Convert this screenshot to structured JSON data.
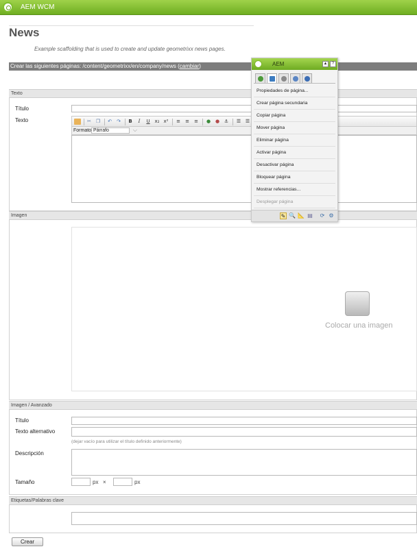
{
  "topbar": {
    "title": "AEM WCM"
  },
  "page": {
    "title": "News",
    "description": "Example scaffolding that is used to create and update geometrixx news pages."
  },
  "create_bar": {
    "prefix": "Crear las siguientes páginas: /content/geometrixx/en/company/news (",
    "link": "cambiar",
    "suffix": ")"
  },
  "sections": {
    "texto": {
      "header": "Texto",
      "title_label": "Título",
      "text_label": "Texto",
      "format_label": "Formato",
      "format_value": "Párrafo"
    },
    "imagen": {
      "header": "Imagen",
      "placeholder": "Colocar una imagen"
    },
    "avanzado": {
      "header": "Imagen / Avanzado",
      "title_label": "Título",
      "alt_label": "Texto alternativo",
      "alt_hint": "(dejar vacío para utilizar el título definido anteriormente)",
      "description_label": "Descripción",
      "size_label": "Tamaño",
      "unit": "px",
      "times": "×"
    },
    "tags": {
      "header": "Etiquetas/Palabras clave"
    }
  },
  "buttons": {
    "create": "Crear"
  },
  "sidekick": {
    "title": "AEM",
    "items": [
      {
        "label": "Propiedades de página...",
        "enabled": true
      },
      {
        "label": "Crear página secundaria",
        "enabled": true
      },
      {
        "label": "Copiar página",
        "enabled": true
      },
      {
        "label": "Mover página",
        "enabled": true
      },
      {
        "label": "Eliminar página",
        "enabled": true
      },
      {
        "label": "Activar página",
        "enabled": true
      },
      {
        "label": "Desactivar página",
        "enabled": true
      },
      {
        "label": "Bloquear página",
        "enabled": true
      },
      {
        "label": "Mostrar referencias...",
        "enabled": true
      },
      {
        "label": "Desplegar página",
        "enabled": false
      }
    ]
  },
  "colors": {
    "brand_green": "#7fbf2e",
    "create_bar": "#7d7d7d",
    "section_header": "#e6e6e6"
  }
}
